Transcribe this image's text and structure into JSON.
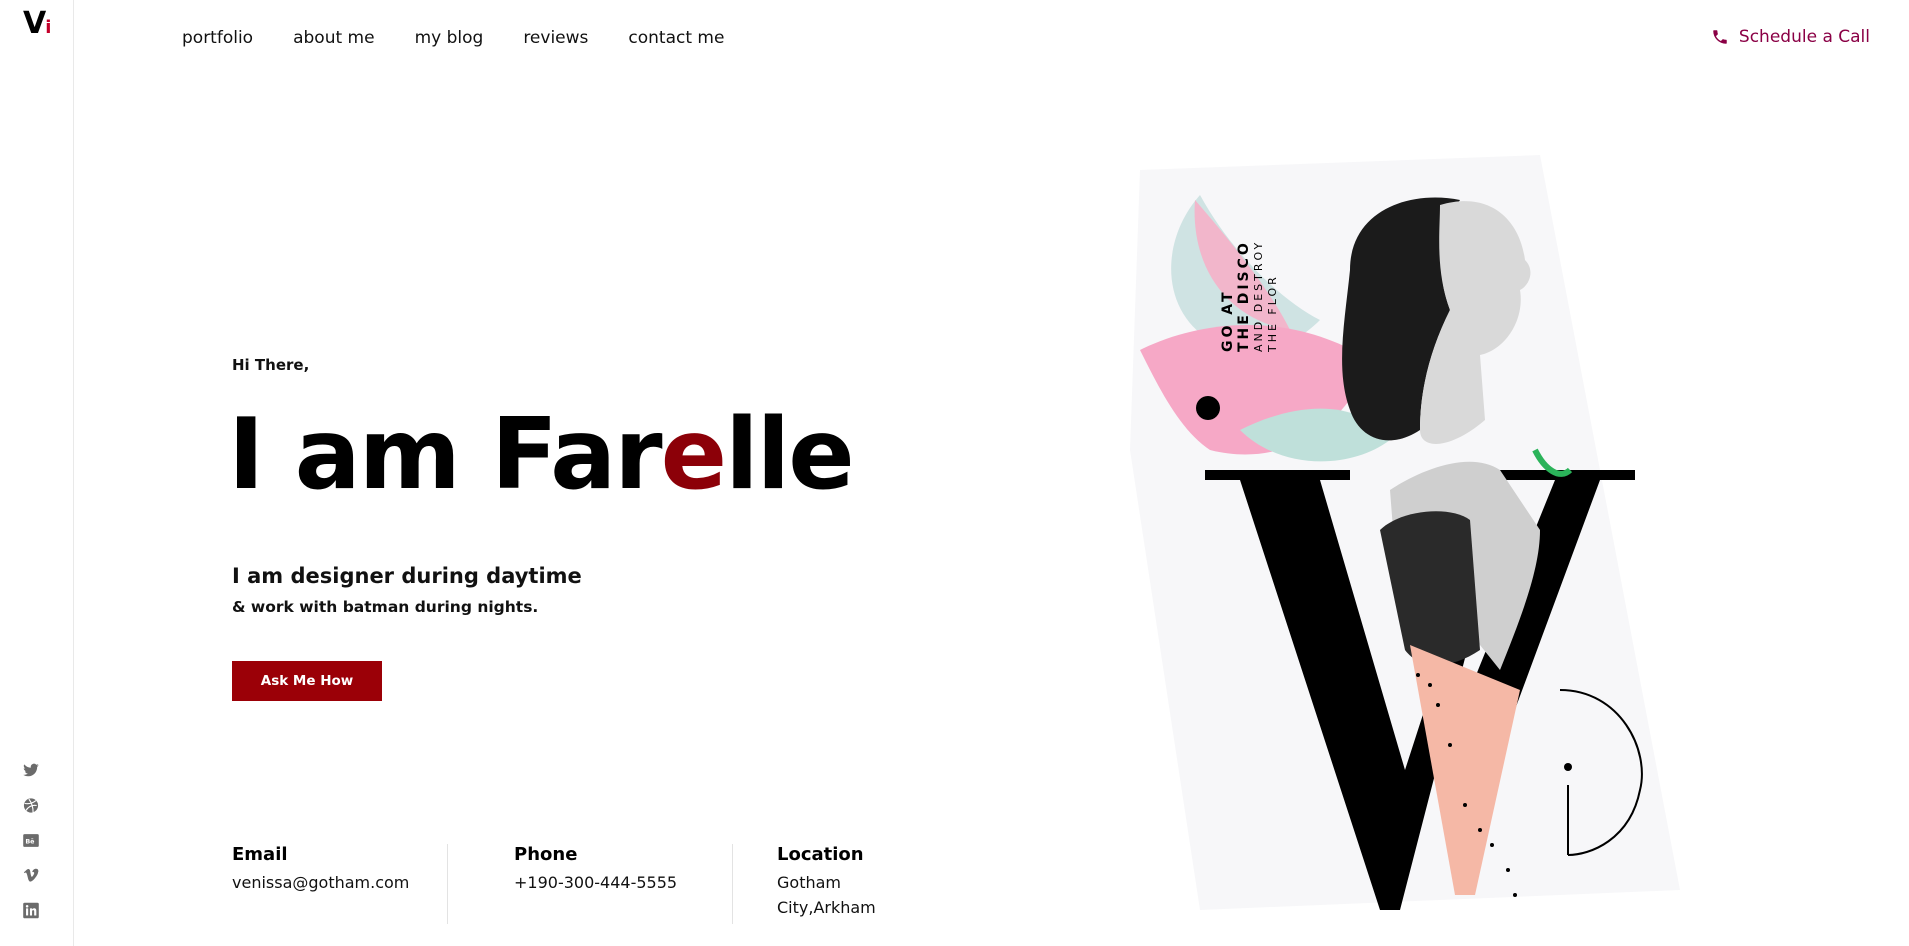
{
  "brand": {
    "logo_main": "V",
    "logo_accent": "i"
  },
  "nav": {
    "items": [
      "portfolio",
      "about me",
      "my blog",
      "reviews",
      "contact me"
    ],
    "schedule_label": "Schedule a Call"
  },
  "hero": {
    "greeting": "Hi There,",
    "headline_part1": "I am Far",
    "headline_highlight": "e",
    "headline_part2": "lle",
    "tagline1": "I am designer during daytime",
    "tagline2": "& work with batman during nights.",
    "cta_label": "Ask Me How"
  },
  "contact": {
    "email_label": "Email",
    "email_value": "venissa@gotham.com",
    "phone_label": "Phone",
    "phone_value": "+190-300-444-5555",
    "location_label": "Location",
    "location_line1": "Gotham",
    "location_line2": "City,Arkham"
  },
  "artwork": {
    "line1": "GO AT",
    "line2": "THE DISCO",
    "line3": "AND DESTROY",
    "line4": "THE FLOR"
  },
  "social": [
    "twitter-icon",
    "dribbble-icon",
    "behance-icon",
    "vimeo-icon",
    "linkedin-icon"
  ],
  "colors": {
    "accent": "#9b0007",
    "headline_highlight": "#8c0008",
    "schedule": "#8a0045",
    "text": "#111111"
  }
}
